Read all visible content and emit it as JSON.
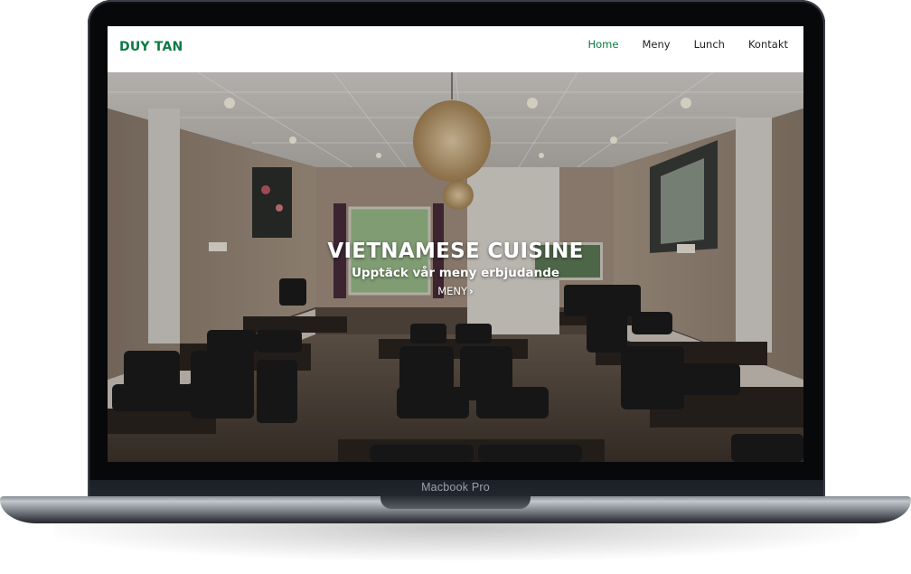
{
  "device": {
    "label": "Macbook Pro"
  },
  "site": {
    "brand": "DUY TAN",
    "nav": [
      {
        "label": "Home",
        "active": true
      },
      {
        "label": "Meny",
        "active": false
      },
      {
        "label": "Lunch",
        "active": false
      },
      {
        "label": "Kontakt",
        "active": false
      }
    ],
    "hero": {
      "title": "VIETNAMESE CUISINE",
      "subtitle": "Upptäck vår meny erbjudande",
      "cta_label": "MENY",
      "cta_icon": "chevron-right-icon"
    }
  },
  "colors": {
    "brand_green": "#0c7a43",
    "text_dark": "#222222",
    "bezel": "#07080a"
  }
}
